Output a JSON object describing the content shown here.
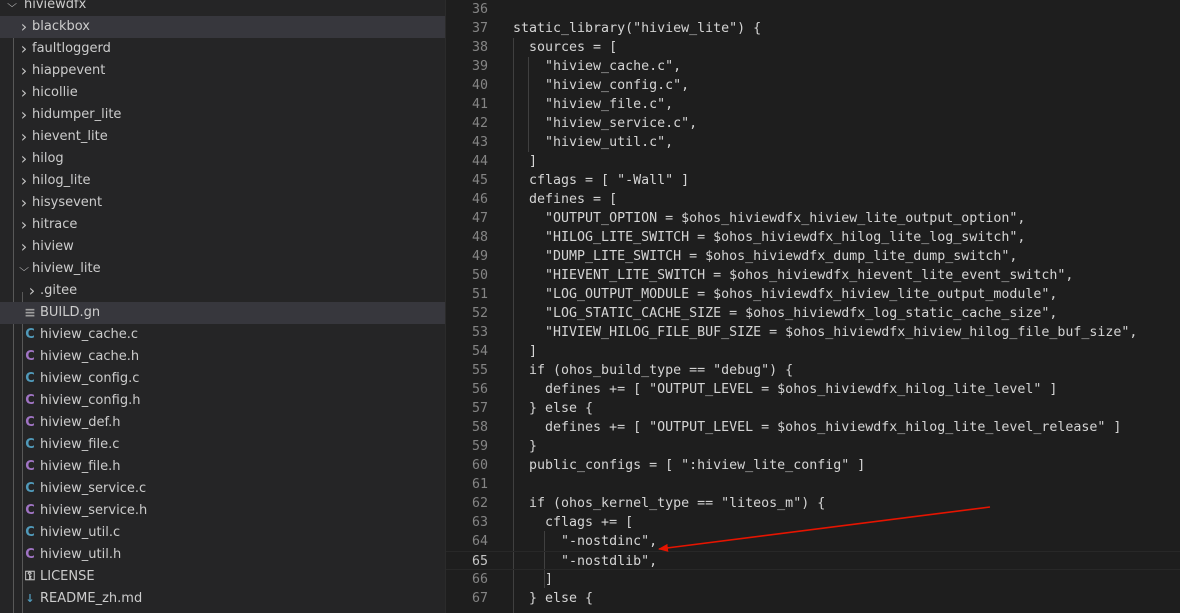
{
  "explorer": {
    "items": [
      {
        "label": "hiviewdfx",
        "kind": "folder",
        "expanded": true,
        "depth": 0,
        "selected": false
      },
      {
        "label": "blackbox",
        "kind": "folder",
        "expanded": false,
        "depth": 1,
        "selected": true
      },
      {
        "label": "faultloggerd",
        "kind": "folder",
        "expanded": false,
        "depth": 1,
        "selected": false
      },
      {
        "label": "hiappevent",
        "kind": "folder",
        "expanded": false,
        "depth": 1,
        "selected": false
      },
      {
        "label": "hicollie",
        "kind": "folder",
        "expanded": false,
        "depth": 1,
        "selected": false
      },
      {
        "label": "hidumper_lite",
        "kind": "folder",
        "expanded": false,
        "depth": 1,
        "selected": false
      },
      {
        "label": "hievent_lite",
        "kind": "folder",
        "expanded": false,
        "depth": 1,
        "selected": false
      },
      {
        "label": "hilog",
        "kind": "folder",
        "expanded": false,
        "depth": 1,
        "selected": false
      },
      {
        "label": "hilog_lite",
        "kind": "folder",
        "expanded": false,
        "depth": 1,
        "selected": false
      },
      {
        "label": "hisysevent",
        "kind": "folder",
        "expanded": false,
        "depth": 1,
        "selected": false
      },
      {
        "label": "hitrace",
        "kind": "folder",
        "expanded": false,
        "depth": 1,
        "selected": false
      },
      {
        "label": "hiview",
        "kind": "folder",
        "expanded": false,
        "depth": 1,
        "selected": false
      },
      {
        "label": "hiview_lite",
        "kind": "folder",
        "expanded": true,
        "depth": 1,
        "selected": false
      },
      {
        "label": ".gitee",
        "kind": "folder",
        "expanded": false,
        "depth": 2,
        "selected": false
      },
      {
        "label": "BUILD.gn",
        "kind": "gn",
        "depth": 2,
        "selected": true
      },
      {
        "label": "hiview_cache.c",
        "kind": "c",
        "depth": 2,
        "selected": false
      },
      {
        "label": "hiview_cache.h",
        "kind": "h",
        "depth": 2,
        "selected": false
      },
      {
        "label": "hiview_config.c",
        "kind": "c",
        "depth": 2,
        "selected": false
      },
      {
        "label": "hiview_config.h",
        "kind": "h",
        "depth": 2,
        "selected": false
      },
      {
        "label": "hiview_def.h",
        "kind": "h",
        "depth": 2,
        "selected": false
      },
      {
        "label": "hiview_file.c",
        "kind": "c",
        "depth": 2,
        "selected": false
      },
      {
        "label": "hiview_file.h",
        "kind": "h",
        "depth": 2,
        "selected": false
      },
      {
        "label": "hiview_service.c",
        "kind": "c",
        "depth": 2,
        "selected": false
      },
      {
        "label": "hiview_service.h",
        "kind": "h",
        "depth": 2,
        "selected": false
      },
      {
        "label": "hiview_util.c",
        "kind": "c",
        "depth": 2,
        "selected": false
      },
      {
        "label": "hiview_util.h",
        "kind": "h",
        "depth": 2,
        "selected": false
      },
      {
        "label": "LICENSE",
        "kind": "license",
        "depth": 2,
        "selected": false
      },
      {
        "label": "README_zh.md",
        "kind": "md",
        "depth": 2,
        "selected": false
      }
    ]
  },
  "editor": {
    "current_line": "65",
    "lines": [
      {
        "no": "36",
        "text": ""
      },
      {
        "no": "37",
        "text": "static_library(\"hiview_lite\") {"
      },
      {
        "no": "38",
        "text": "  sources = ["
      },
      {
        "no": "39",
        "text": "    \"hiview_cache.c\","
      },
      {
        "no": "40",
        "text": "    \"hiview_config.c\","
      },
      {
        "no": "41",
        "text": "    \"hiview_file.c\","
      },
      {
        "no": "42",
        "text": "    \"hiview_service.c\","
      },
      {
        "no": "43",
        "text": "    \"hiview_util.c\","
      },
      {
        "no": "44",
        "text": "  ]"
      },
      {
        "no": "45",
        "text": "  cflags = [ \"-Wall\" ]"
      },
      {
        "no": "46",
        "text": "  defines = ["
      },
      {
        "no": "47",
        "text": "    \"OUTPUT_OPTION = $ohos_hiviewdfx_hiview_lite_output_option\","
      },
      {
        "no": "48",
        "text": "    \"HILOG_LITE_SWITCH = $ohos_hiviewdfx_hilog_lite_log_switch\","
      },
      {
        "no": "49",
        "text": "    \"DUMP_LITE_SWITCH = $ohos_hiviewdfx_dump_lite_dump_switch\","
      },
      {
        "no": "50",
        "text": "    \"HIEVENT_LITE_SWITCH = $ohos_hiviewdfx_hievent_lite_event_switch\","
      },
      {
        "no": "51",
        "text": "    \"LOG_OUTPUT_MODULE = $ohos_hiviewdfx_hiview_lite_output_module\","
      },
      {
        "no": "52",
        "text": "    \"LOG_STATIC_CACHE_SIZE = $ohos_hiviewdfx_log_static_cache_size\","
      },
      {
        "no": "53",
        "text": "    \"HIVIEW_HILOG_FILE_BUF_SIZE = $ohos_hiviewdfx_hiview_hilog_file_buf_size\","
      },
      {
        "no": "54",
        "text": "  ]"
      },
      {
        "no": "55",
        "text": "  if (ohos_build_type == \"debug\") {"
      },
      {
        "no": "56",
        "text": "    defines += [ \"OUTPUT_LEVEL = $ohos_hiviewdfx_hilog_lite_level\" ]"
      },
      {
        "no": "57",
        "text": "  } else {"
      },
      {
        "no": "58",
        "text": "    defines += [ \"OUTPUT_LEVEL = $ohos_hiviewdfx_hilog_lite_level_release\" ]"
      },
      {
        "no": "59",
        "text": "  }"
      },
      {
        "no": "60",
        "text": "  public_configs = [ \":hiview_lite_config\" ]"
      },
      {
        "no": "61",
        "text": ""
      },
      {
        "no": "62",
        "text": "  if (ohos_kernel_type == \"liteos_m\") {"
      },
      {
        "no": "63",
        "text": "    cflags += ["
      },
      {
        "no": "64",
        "text": "      \"-nostdinc\","
      },
      {
        "no": "65",
        "text": "      \"-nostdlib\","
      },
      {
        "no": "66",
        "text": "    ]"
      },
      {
        "no": "67",
        "text": "  } else {"
      }
    ]
  },
  "annotation": {
    "color": "#e51400",
    "shape": "arrow",
    "points_to_line": "64"
  }
}
